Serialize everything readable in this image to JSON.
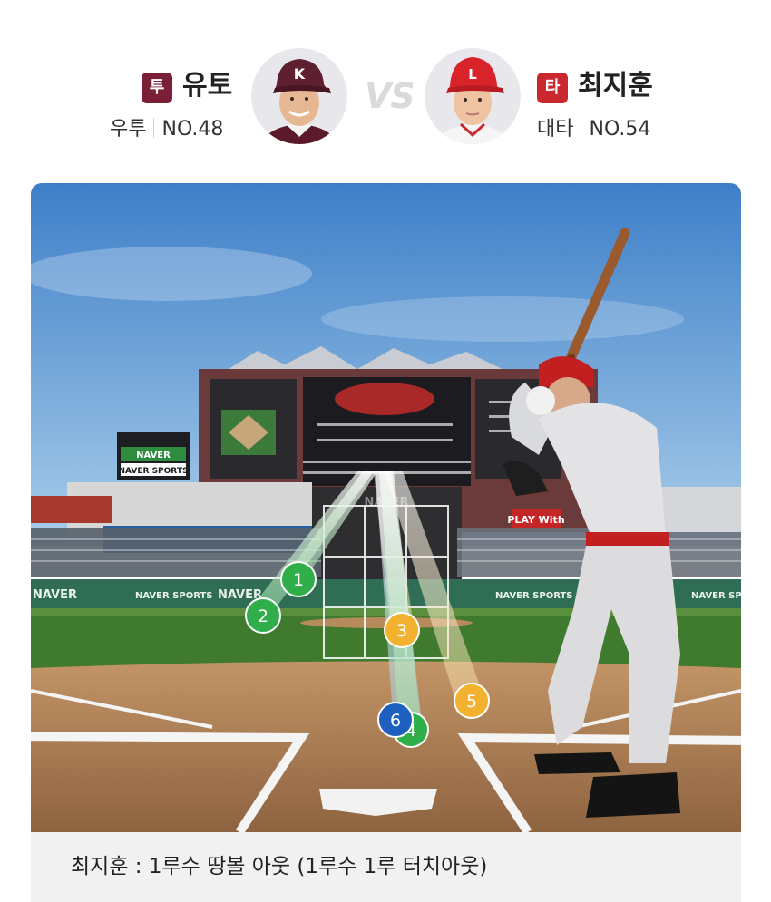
{
  "pitcher": {
    "role_badge": "투",
    "name": "유토",
    "hand": "우투",
    "number": "NO.48",
    "badge_color": "#7a1f35",
    "team_logo_letter": "K"
  },
  "vs_label": "VS",
  "batter": {
    "role_badge": "타",
    "name": "최지훈",
    "hand": "대타",
    "number": "NO.54",
    "badge_color": "#c8282e",
    "team_logo_letter": "L"
  },
  "scene": {
    "banner_top": "NAVER",
    "banner_bottom": "NAVER SPORTS",
    "wall_ads": [
      "NAVER",
      "NAVER SPORTS",
      "NAVER",
      "NAVER SPORTS",
      "NAVER SPORTS"
    ],
    "scoreboard_sign": "PLAY With",
    "scoreboard_label": "NAVER"
  },
  "pitches": [
    {
      "num": "1",
      "color": "#2fae4a"
    },
    {
      "num": "2",
      "color": "#2fae4a"
    },
    {
      "num": "3",
      "color": "#f2b230"
    },
    {
      "num": "4",
      "color": "#2fae4a"
    },
    {
      "num": "5",
      "color": "#f2b230"
    },
    {
      "num": "6",
      "color": "#1e5fbf"
    }
  ],
  "result_text": "최지훈 : 1루수 땅볼 아웃 (1루수 1루 터치아웃)"
}
